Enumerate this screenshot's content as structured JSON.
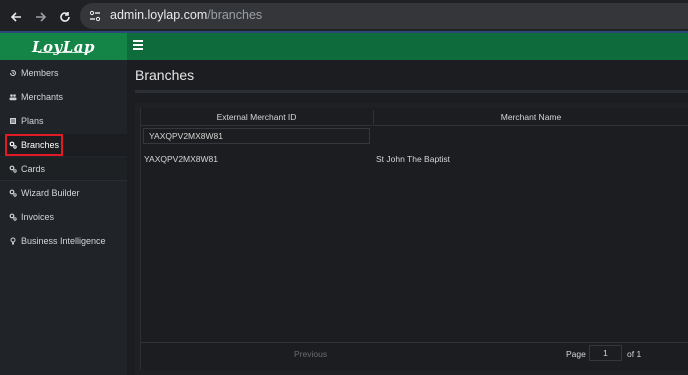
{
  "browser": {
    "url_host": "admin.loylap.com",
    "url_path": "/branches"
  },
  "header": {
    "logo_text": "LoyLap"
  },
  "sidebar": {
    "items": [
      {
        "label": "Members",
        "icon": "history-icon"
      },
      {
        "label": "Merchants",
        "icon": "users-icon"
      },
      {
        "label": "Plans",
        "icon": "list-icon"
      },
      {
        "label": "Branches",
        "icon": "cogs-icon"
      },
      {
        "label": "Cards",
        "icon": "cogs-icon"
      },
      {
        "label": "Wizard Builder",
        "icon": "cogs-icon"
      },
      {
        "label": "Invoices",
        "icon": "cogs-icon"
      },
      {
        "label": "Business Intelligence",
        "icon": "lightbulb-icon"
      }
    ],
    "active": "Branches"
  },
  "main": {
    "title": "Branches",
    "columns": [
      "External Merchant ID",
      "Merchant Name"
    ],
    "filter_value": "YAXQPV2MX8W81",
    "rows": [
      {
        "external_id": "YAXQPV2MX8W81",
        "merchant_name": "St John The Baptist"
      }
    ],
    "pagination": {
      "previous_label": "Previous",
      "page_label": "Page",
      "page_value": "1",
      "of_label": "of 1"
    }
  },
  "colors": {
    "header_green": "#0d6b3c",
    "logo_green": "#148447",
    "highlight_red": "#e01b24"
  }
}
